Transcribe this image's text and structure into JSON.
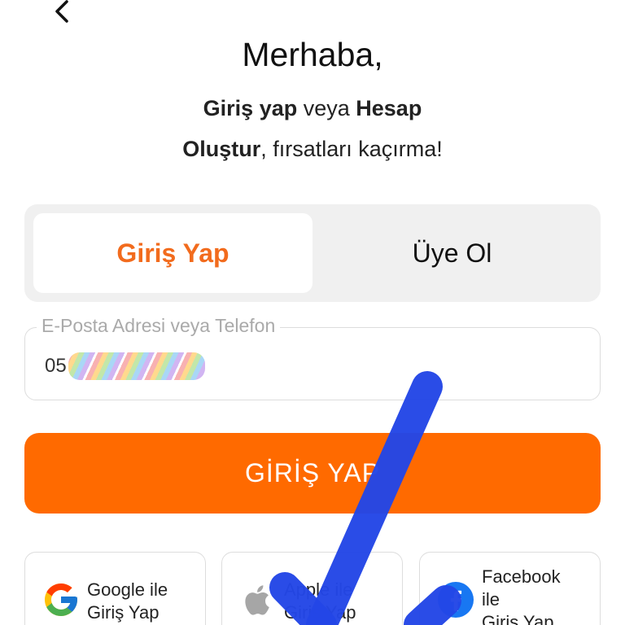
{
  "header": {
    "back_icon": "chevron-left-icon",
    "title": "Merhaba,",
    "subtitle_part1": "Giriş yap",
    "subtitle_part2": " veya ",
    "subtitle_part3": "Hesap",
    "subtitle_part4": "Oluştur",
    "subtitle_part5": ", fırsatları kaçırma!"
  },
  "tabs": {
    "login_label": "Giriş Yap",
    "signup_label": "Üye Ol",
    "active": "login"
  },
  "login_field": {
    "label": "E-Posta Adresi veya Telefon",
    "value_prefix": "05"
  },
  "login_button": {
    "label": "GİRİŞ YAP"
  },
  "social": {
    "google_line1": "Google ile",
    "google_line2": "Giriş Yap",
    "apple_line1": "Apple ile",
    "apple_line2": "Giriş Yap",
    "facebook_line1": "Facebook",
    "facebook_line2": "ile",
    "facebook_line3": "Giriş Yap"
  },
  "colors": {
    "accent": "#ff6a00",
    "tab_active_text": "#f26b1d",
    "annotation": "#2346e6"
  }
}
